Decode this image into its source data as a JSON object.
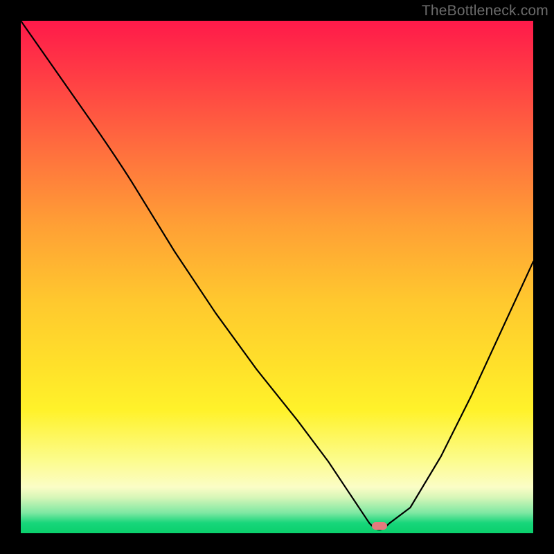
{
  "watermark": "TheBottleneck.com",
  "chart_data": {
    "type": "line",
    "title": "",
    "xlabel": "",
    "ylabel": "",
    "xlim": [
      0,
      1
    ],
    "ylim": [
      0,
      1
    ],
    "series": [
      {
        "name": "curve",
        "x": [
          0.0,
          0.07,
          0.14,
          0.22,
          0.3,
          0.38,
          0.46,
          0.54,
          0.6,
          0.64,
          0.68,
          0.72,
          0.76,
          0.82,
          0.88,
          0.94,
          1.0
        ],
        "y": [
          1.0,
          0.9,
          0.8,
          0.68,
          0.55,
          0.43,
          0.32,
          0.22,
          0.14,
          0.08,
          0.02,
          0.02,
          0.05,
          0.15,
          0.27,
          0.4,
          0.53
        ]
      }
    ],
    "marker": {
      "x": 0.7,
      "y": 0.012
    },
    "background_gradient": {
      "top": "#ff1a4a",
      "mid": "#ffe22a",
      "bottom": "#0acf6c"
    }
  }
}
